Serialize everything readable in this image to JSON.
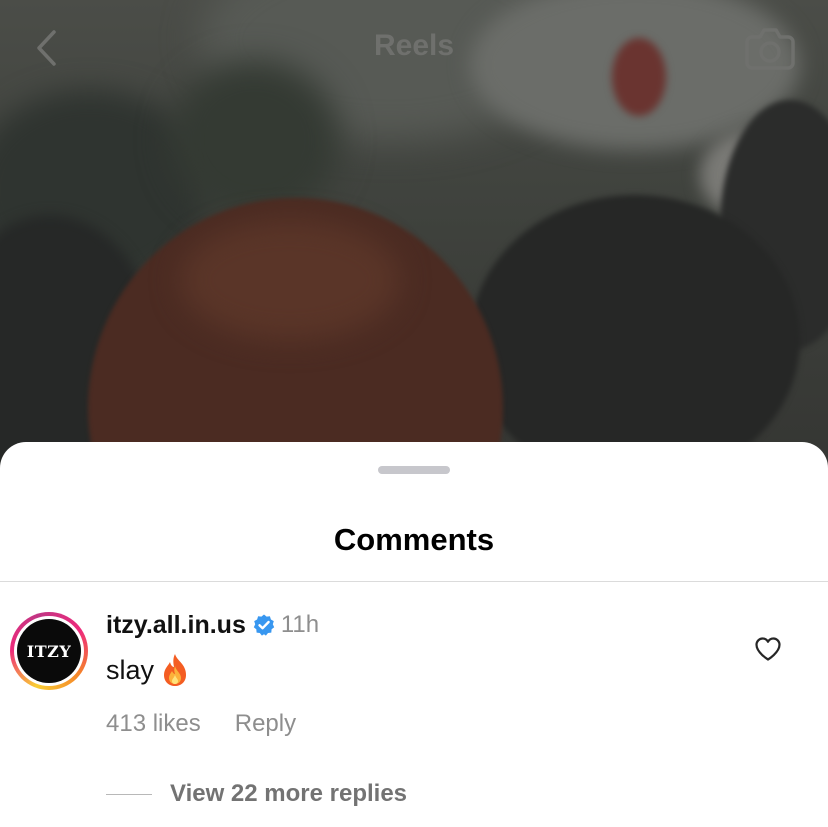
{
  "header": {
    "title": "Reels",
    "back_icon": "chevron-left-icon",
    "camera_icon": "camera-icon"
  },
  "sheet": {
    "title": "Comments"
  },
  "comment": {
    "avatar_text": "ITZY",
    "username": "itzy.all.in.us",
    "verified": true,
    "verified_color": "#3897f0",
    "time": "11h",
    "text": "slay",
    "emoji_icon": "fire-icon",
    "likes": "413 likes",
    "reply_label": "Reply",
    "like_icon": "heart-outline-icon",
    "view_replies": "View 22 more replies"
  },
  "colors": {
    "sheet_bg": "#ffffff",
    "secondary_text": "#8e8e8e",
    "primary_text": "#111111"
  }
}
